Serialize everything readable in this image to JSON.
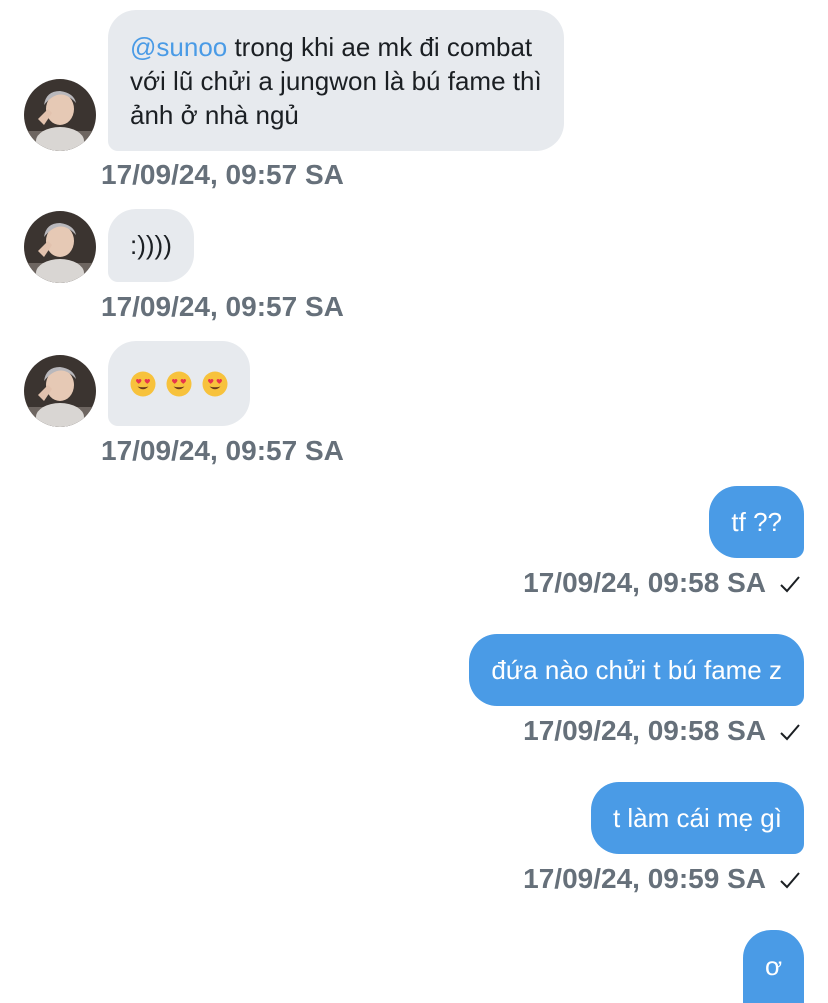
{
  "messages": {
    "m1": {
      "mention": "@sunoo",
      "line1": " trong khi ae mk đi combat",
      "line2": "với lũ chửi a jungwon là bú fame thì",
      "line3": "ảnh ở nhà ngủ",
      "time": "17/09/24, 09:57 SA"
    },
    "m2": {
      "text": ":))))",
      "time": "17/09/24, 09:57 SA"
    },
    "m3": {
      "emojis": [
        "heart-eyes-emoji",
        "heart-eyes-emoji",
        "heart-eyes-emoji"
      ],
      "time": "17/09/24, 09:57 SA"
    },
    "m4": {
      "text": "tf ??",
      "time": "17/09/24, 09:58 SA"
    },
    "m5": {
      "text": "đứa nào chửi t bú fame z",
      "time": "17/09/24, 09:58 SA"
    },
    "m6": {
      "text": "t làm cái mẹ gì",
      "time": "17/09/24, 09:59 SA"
    },
    "m7": {
      "text": "ơ"
    }
  },
  "colors": {
    "incoming_bubble": "#e7eaee",
    "outgoing_bubble": "#4a9be6",
    "timestamp": "#66707a",
    "mention": "#4a9be6"
  }
}
